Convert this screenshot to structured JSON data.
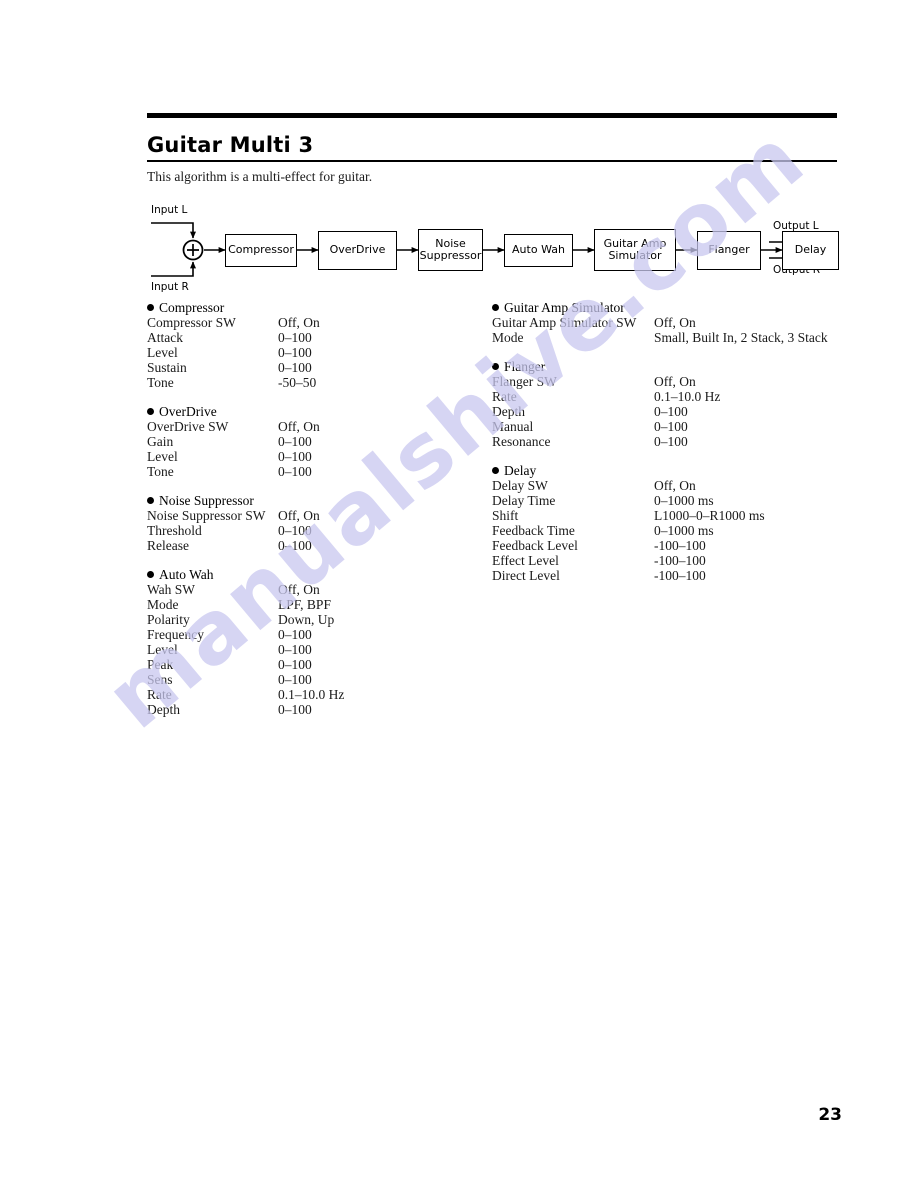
{
  "document": {
    "title": "Guitar Multi 3",
    "intro": "This algorithm is a multi-effect for guitar.",
    "page_number": "23",
    "watermark": "manualshive.com"
  },
  "diagram": {
    "input_l_label": "Input L",
    "input_r_label": "Input R",
    "output_l_label": "Output L",
    "output_r_label": "Output R",
    "mixer_symbol": "+",
    "blocks": [
      {
        "label": "Compressor"
      },
      {
        "label": "OverDrive"
      },
      {
        "label": "Noise\nSuppressor",
        "line1": "Noise",
        "line2": "Suppressor"
      },
      {
        "label": "Auto Wah"
      },
      {
        "label": "Guitar Amp\nSimulator",
        "line1": "Guitar Amp",
        "line2": "Simulator"
      },
      {
        "label": "Flanger"
      },
      {
        "label": "Delay"
      }
    ]
  },
  "left_column": [
    {
      "heading": "Compressor",
      "rows": [
        {
          "name": "Compressor SW",
          "value": "Off, On"
        },
        {
          "name": "Attack",
          "value": "0–100"
        },
        {
          "name": "Level",
          "value": "0–100"
        },
        {
          "name": "Sustain",
          "value": "0–100"
        },
        {
          "name": "Tone",
          "value": "-50–50"
        }
      ]
    },
    {
      "heading": "OverDrive",
      "rows": [
        {
          "name": "OverDrive SW",
          "value": "Off, On"
        },
        {
          "name": "Gain",
          "value": "0–100"
        },
        {
          "name": "Level",
          "value": "0–100"
        },
        {
          "name": "Tone",
          "value": "0–100"
        }
      ]
    },
    {
      "heading": "Noise Suppressor",
      "rows": [
        {
          "name": "Noise Suppressor SW",
          "value": "Off, On"
        },
        {
          "name": "Threshold",
          "value": "0–100"
        },
        {
          "name": "Release",
          "value": "0–100"
        }
      ]
    },
    {
      "heading": "Auto Wah",
      "rows": [
        {
          "name": "Wah SW",
          "value": "Off, On"
        },
        {
          "name": "Mode",
          "value": "LPF, BPF"
        },
        {
          "name": "Polarity",
          "value": "Down, Up"
        },
        {
          "name": "Frequency",
          "value": "0–100"
        },
        {
          "name": "Level",
          "value": "0–100"
        },
        {
          "name": "Peak",
          "value": "0–100"
        },
        {
          "name": "Sens",
          "value": "0–100"
        },
        {
          "name": "Rate",
          "value": "0.1–10.0 Hz"
        },
        {
          "name": "Depth",
          "value": "0–100"
        }
      ]
    }
  ],
  "right_column": [
    {
      "heading": "Guitar Amp Simulator",
      "rows": [
        {
          "name": "Guitar Amp Simulator SW",
          "value": "Off, On"
        },
        {
          "name": "Mode",
          "value": "Small, Built In, 2 Stack, 3 Stack"
        }
      ]
    },
    {
      "heading": "Flanger",
      "rows": [
        {
          "name": "Flanger SW",
          "value": "Off, On"
        },
        {
          "name": "Rate",
          "value": "0.1–10.0 Hz"
        },
        {
          "name": "Depth",
          "value": "0–100"
        },
        {
          "name": "Manual",
          "value": "0–100"
        },
        {
          "name": "Resonance",
          "value": "0–100"
        }
      ]
    },
    {
      "heading": "Delay",
      "rows": [
        {
          "name": "Delay SW",
          "value": "Off, On"
        },
        {
          "name": "Delay Time",
          "value": "0–1000 ms"
        },
        {
          "name": "Shift",
          "value": "L1000–0–R1000 ms"
        },
        {
          "name": "Feedback Time",
          "value": "0–1000 ms"
        },
        {
          "name": "Feedback Level",
          "value": "-100–100"
        },
        {
          "name": "Effect Level",
          "value": "-100–100"
        },
        {
          "name": "Direct Level",
          "value": "-100–100"
        }
      ]
    }
  ]
}
